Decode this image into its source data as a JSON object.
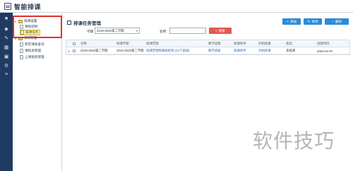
{
  "app": {
    "title": "智能排课"
  },
  "tree": {
    "root_label": "排课设置",
    "item_room": "课程结构",
    "item_task": "排课任务",
    "group2_label": "排课管理",
    "item_a": "校历课表查询",
    "item_b": "课程表管理",
    "item_c": "上课班别管理"
  },
  "panel": {
    "title": "排课任务管理"
  },
  "toolbar": {
    "add": "添加",
    "edit": "修改",
    "delete": "删除"
  },
  "filter": {
    "term_label": "学期",
    "term_value": "2019-2020第二学期",
    "name_label": "名称:",
    "name_value": "",
    "search": "搜索"
  },
  "table": {
    "headers": [
      "名称",
      "排课学期",
      "排课范围",
      "教学班级",
      "排课条件",
      "开始排课",
      "状态",
      "创建时间"
    ],
    "rows": [
      {
        "index": "1",
        "name": "2019-2020第二学期",
        "term": "2019-2020第二学期",
        "scope": "排课范围和课表结构 (12个班级)",
        "classes": "教学班级",
        "conditions": "排课条件",
        "start": "开始排课",
        "status": "未排课",
        "created": "2020-04-07"
      }
    ]
  },
  "watermark": {
    "text": "软件技巧"
  }
}
